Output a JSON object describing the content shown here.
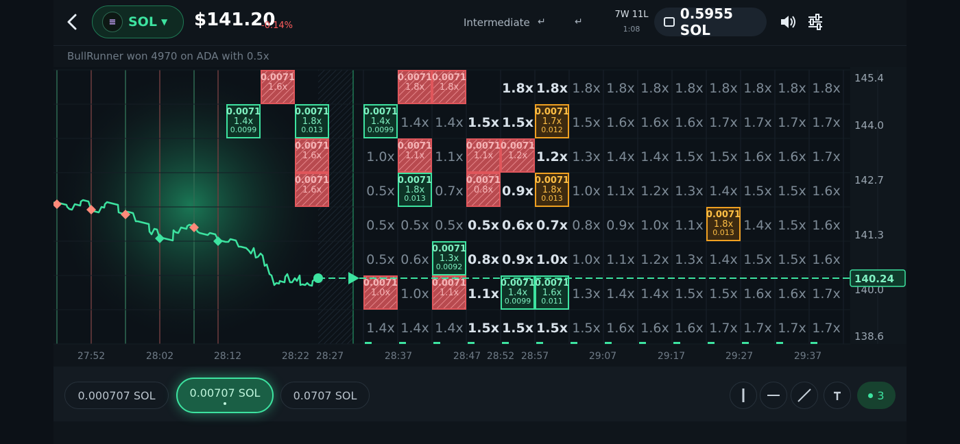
{
  "header": {
    "asset_symbol": "SOL",
    "asset_logo_glyph": "≡",
    "price": "$141.20",
    "change": "-0.14%",
    "mode_label": "Intermediate",
    "record": "7W 11L",
    "timer": "1:08",
    "wallet_balance": "0.5955 SOL"
  },
  "ticker": {
    "message": "BullRunner won 4970 on ADA with 0.5x"
  },
  "chart": {
    "price_axis": [
      "145.4",
      "144.0",
      "142.7",
      "141.3",
      "140.0",
      "138.6"
    ],
    "current_price": "140.24",
    "time_axis": [
      "27:52",
      "28:02",
      "28:12",
      "28:22",
      "28:27",
      "28:37",
      "28:47",
      "28:52",
      "28:57",
      "29:07",
      "29:17",
      "29:27",
      "29:37"
    ],
    "grid_rows": [
      [
        "",
        "1.8x",
        "",
        "",
        "1.8x",
        "1.8x",
        "1.8x",
        "1.8x",
        "1.8x",
        "1.8x",
        "1.8x",
        "1.8x",
        "1.8x",
        "1.8x",
        "1.8x",
        "1"
      ],
      [
        "",
        "1.4x",
        "1.4x",
        "1.5x",
        "1.5x",
        "",
        "1.5x",
        "1.6x",
        "1.6x",
        "1.6x",
        "1.7x",
        "1.7x",
        "1.7x",
        "1.7x",
        "1"
      ],
      [
        "1.0x",
        "",
        "1.1x",
        "",
        "",
        "1.2x",
        "1.3x",
        "1.4x",
        "1.4x",
        "1.5x",
        "1.5x",
        "1.6x",
        "1.6x",
        "1.7x",
        "1"
      ],
      [
        "0.5x",
        "",
        "0.7x",
        "",
        "0.9x",
        "",
        "1.0x",
        "1.1x",
        "1.2x",
        "1.3x",
        "1.4x",
        "1.5x",
        "1.5x",
        "1.6x",
        "1"
      ],
      [
        "0.5x",
        "0.5x",
        "0.5x",
        "0.5x",
        "0.6x",
        "0.7x",
        "0.8x",
        "0.9x",
        "1.0x",
        "1.1x",
        "",
        "1.4x",
        "1.5x",
        "1.6x",
        "1"
      ],
      [
        "0.5x",
        "0.6x",
        "",
        "0.8x",
        "0.9x",
        "1.0x",
        "1.0x",
        "1.1x",
        "1.2x",
        "1.3x",
        "1.4x",
        "1.5x",
        "1.5x",
        "1.6x",
        "1"
      ],
      [
        "",
        "1.0x",
        "",
        "1.1x",
        "",
        "",
        "1.3x",
        "1.4x",
        "1.4x",
        "1.5x",
        "1.5x",
        "1.6x",
        "1.6x",
        "1.7x",
        "1"
      ],
      [
        "1.4x",
        "1.4x",
        "1.4x",
        "1.5x",
        "1.5x",
        "1.5x",
        "1.5x",
        "1.6x",
        "1.6x",
        "1.6x",
        "1.7x",
        "1.7x",
        "1.7x",
        "1.7x",
        "1"
      ]
    ],
    "green_bets": [
      {
        "row": 1,
        "past_col": 0,
        "stake": "0.0071",
        "mult": "1.4x",
        "payout": "0.0099"
      },
      {
        "row": 1,
        "past_col": 2,
        "stake": "0.0071",
        "mult": "1.8x",
        "payout": "0.013"
      },
      {
        "row": 1,
        "col": 0,
        "stake": "0.0071",
        "mult": "1.4x",
        "payout": "0.0099"
      },
      {
        "row": 3,
        "col": 1,
        "stake": "0.0071",
        "mult": "1.8x",
        "payout": "0.013"
      },
      {
        "row": 5,
        "col": 2,
        "stake": "0.0071",
        "mult": "1.3x",
        "payout": "0.0092"
      },
      {
        "row": 6,
        "col": 4,
        "stake": "0.0071",
        "mult": "1.4x",
        "payout": "0.0099"
      },
      {
        "row": 6,
        "col": 5,
        "stake": "0.0071",
        "mult": "1.6x",
        "payout": "0.011"
      }
    ],
    "orange_bets": [
      {
        "row": 1,
        "col": 5,
        "stake": "0.0071",
        "mult": "1.7x",
        "payout": "0.012"
      },
      {
        "row": 3,
        "col": 5,
        "stake": "0.0071",
        "mult": "1.8x",
        "payout": "0.013"
      },
      {
        "row": 4,
        "col": 10,
        "stake": "0.0071",
        "mult": "1.8x",
        "payout": "0.013"
      }
    ],
    "red_cells": [
      {
        "row": 0,
        "col": 1,
        "stake": "0.0071",
        "mult": "1.8x"
      },
      {
        "row": 0,
        "col": 2,
        "stake": "0.0071",
        "mult": "1.8x"
      },
      {
        "row": 2,
        "col": 1,
        "stake": "0.0071",
        "mult": "1.1x"
      },
      {
        "row": 2,
        "col": 3,
        "stake": "0.0071",
        "mult": "1.1x"
      },
      {
        "row": 2,
        "col": 4,
        "stake": "0.0071",
        "mult": "1.2x"
      },
      {
        "row": 3,
        "col": 3,
        "stake": "0.0071",
        "mult": "0.8x"
      },
      {
        "row": 6,
        "col": 0,
        "stake": "0.0071",
        "mult": "1.0x"
      },
      {
        "row": 6,
        "col": 2,
        "stake": "0.0071",
        "mult": "1.1x"
      }
    ],
    "past_red_cells": [
      {
        "row": 0,
        "past_col": 1,
        "stake": "0.0071",
        "mult": "1.6x"
      },
      {
        "row": 2,
        "past_col": 2,
        "stake": "0.0071",
        "mult": "1.6x"
      },
      {
        "row": 3,
        "past_col": 2,
        "stake": "0.0071",
        "mult": "1.6x"
      }
    ]
  },
  "bottom": {
    "amounts": [
      "0.000707 SOL",
      "0.00707 SOL",
      "0.0707 SOL"
    ],
    "selected_index": 1,
    "active_count": "3"
  },
  "colors": {
    "accent": "#3de3a0",
    "loss": "#e0565b",
    "pending": "#f0a020",
    "background": "#0f151b"
  }
}
